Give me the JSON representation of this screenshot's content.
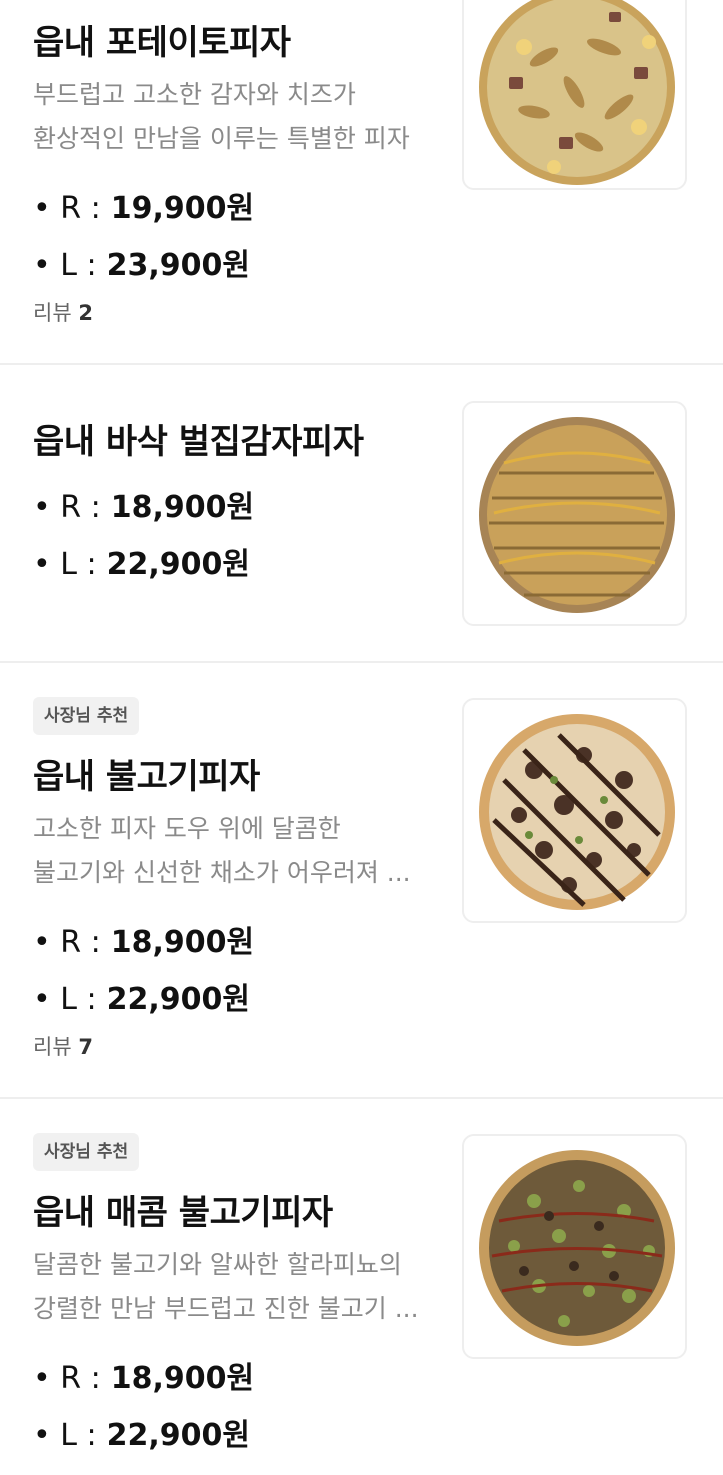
{
  "items": [
    {
      "name": "읍내 포테이토피자",
      "desc_line1": "부드럽고 고소한 감자와 치즈가",
      "desc_line2": "환상적인 만남을 이루는 특별한 피자",
      "price_r_label": "• R :",
      "price_r": "19,900원",
      "price_l_label": "• L :",
      "price_l": "23,900원",
      "reviews_label": "리뷰",
      "reviews_count": "2"
    },
    {
      "name": "읍내 바삭 벌집감자피자",
      "price_r_label": "• R :",
      "price_r": "18,900원",
      "price_l_label": "• L :",
      "price_l": "22,900원"
    },
    {
      "badge": "사장님 추천",
      "name": "읍내 불고기피자",
      "desc_line1": "고소한 피자 도우 위에 달콤한",
      "desc_line2": "불고기와 신선한 채소가 어우러져 ...",
      "price_r_label": "• R :",
      "price_r": "18,900원",
      "price_l_label": "• L :",
      "price_l": "22,900원",
      "reviews_label": "리뷰",
      "reviews_count": "7"
    },
    {
      "badge": "사장님 추천",
      "name": "읍내 매콤 불고기피자",
      "desc_line1": "달콤한 불고기와 알싸한 할라피뇨의",
      "desc_line2": "강렬한 만남 부드럽고 진한 불고기 ...",
      "price_r_label": "• R :",
      "price_r": "18,900원",
      "price_l_label": "• L :",
      "price_l": "22,900원"
    }
  ],
  "colors": {
    "divider": "#eeeeee",
    "badge_bg": "#f1f1f1",
    "desc_text": "#8a8a8a"
  },
  "icons": [
    "potato-pizza-image",
    "honeycomb-potato-pizza-image",
    "bulgogi-pizza-image",
    "spicy-bulgogi-pizza-image"
  ]
}
